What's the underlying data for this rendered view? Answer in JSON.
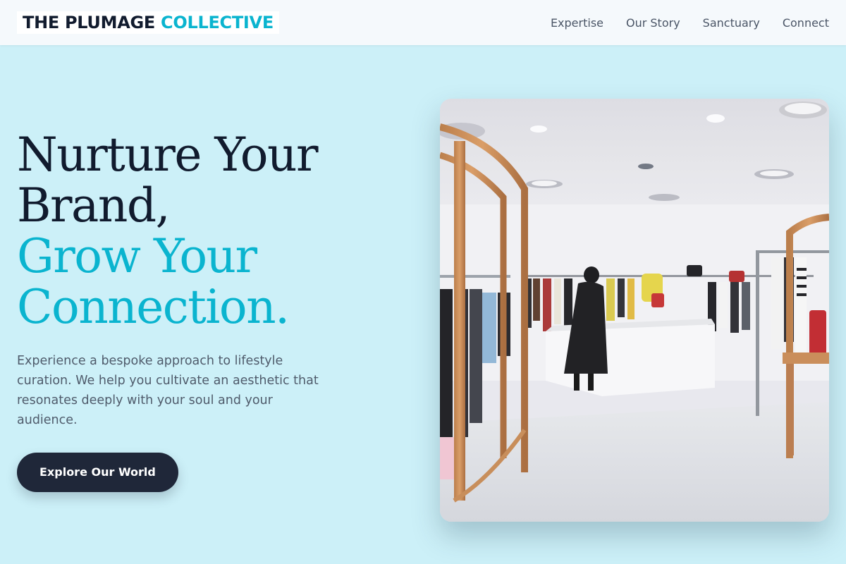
{
  "header": {
    "logo_part1": "THE PLUMAGE",
    "logo_part2": "COLLECTIVE",
    "nav": [
      "Expertise",
      "Our Story",
      "Sanctuary",
      "Connect"
    ]
  },
  "hero": {
    "headline_line1": "Nurture Your",
    "headline_line2": "Brand,",
    "headline_line3": "Grow Your",
    "headline_line4": "Connection.",
    "description": "Experience a bespoke approach to lifestyle curation. We help you cultivate an aesthetic that resonates deeply with your soul and your audience.",
    "cta_label": "Explore Our World",
    "image_alt": "Bright clothing boutique interior with racks, wooden arches and a shopper"
  },
  "colors": {
    "background": "#ccf0f8",
    "header_bg": "#f5f9fc",
    "dark": "#111b2e",
    "accent": "#0ab4cf",
    "body_text": "#4f5b6b",
    "button_bg": "#1f2739"
  }
}
